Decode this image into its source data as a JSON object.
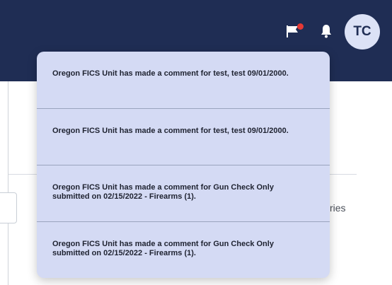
{
  "header": {
    "avatar_initials": "TC",
    "icons": {
      "flag": "flag-icon",
      "bell": "bell-icon",
      "flag_dot_color": "#e53935"
    },
    "background_color": "#1f2d54"
  },
  "background": {
    "partial_text": "ries"
  },
  "notifications": {
    "items": [
      {
        "text": "Oregon FICS Unit has made a comment for test, test 09/01/2000."
      },
      {
        "text": "Oregon FICS Unit has made a comment for test, test 09/01/2000."
      },
      {
        "text": "Oregon FICS Unit has made a comment for Gun Check Only submitted on 02/15/2022 - Firearms (1)."
      },
      {
        "text": "Oregon FICS Unit has made a comment for Gun Check Only submitted on 02/15/2022 - Firearms (1)."
      }
    ],
    "panel_color": "#d4daf4"
  }
}
